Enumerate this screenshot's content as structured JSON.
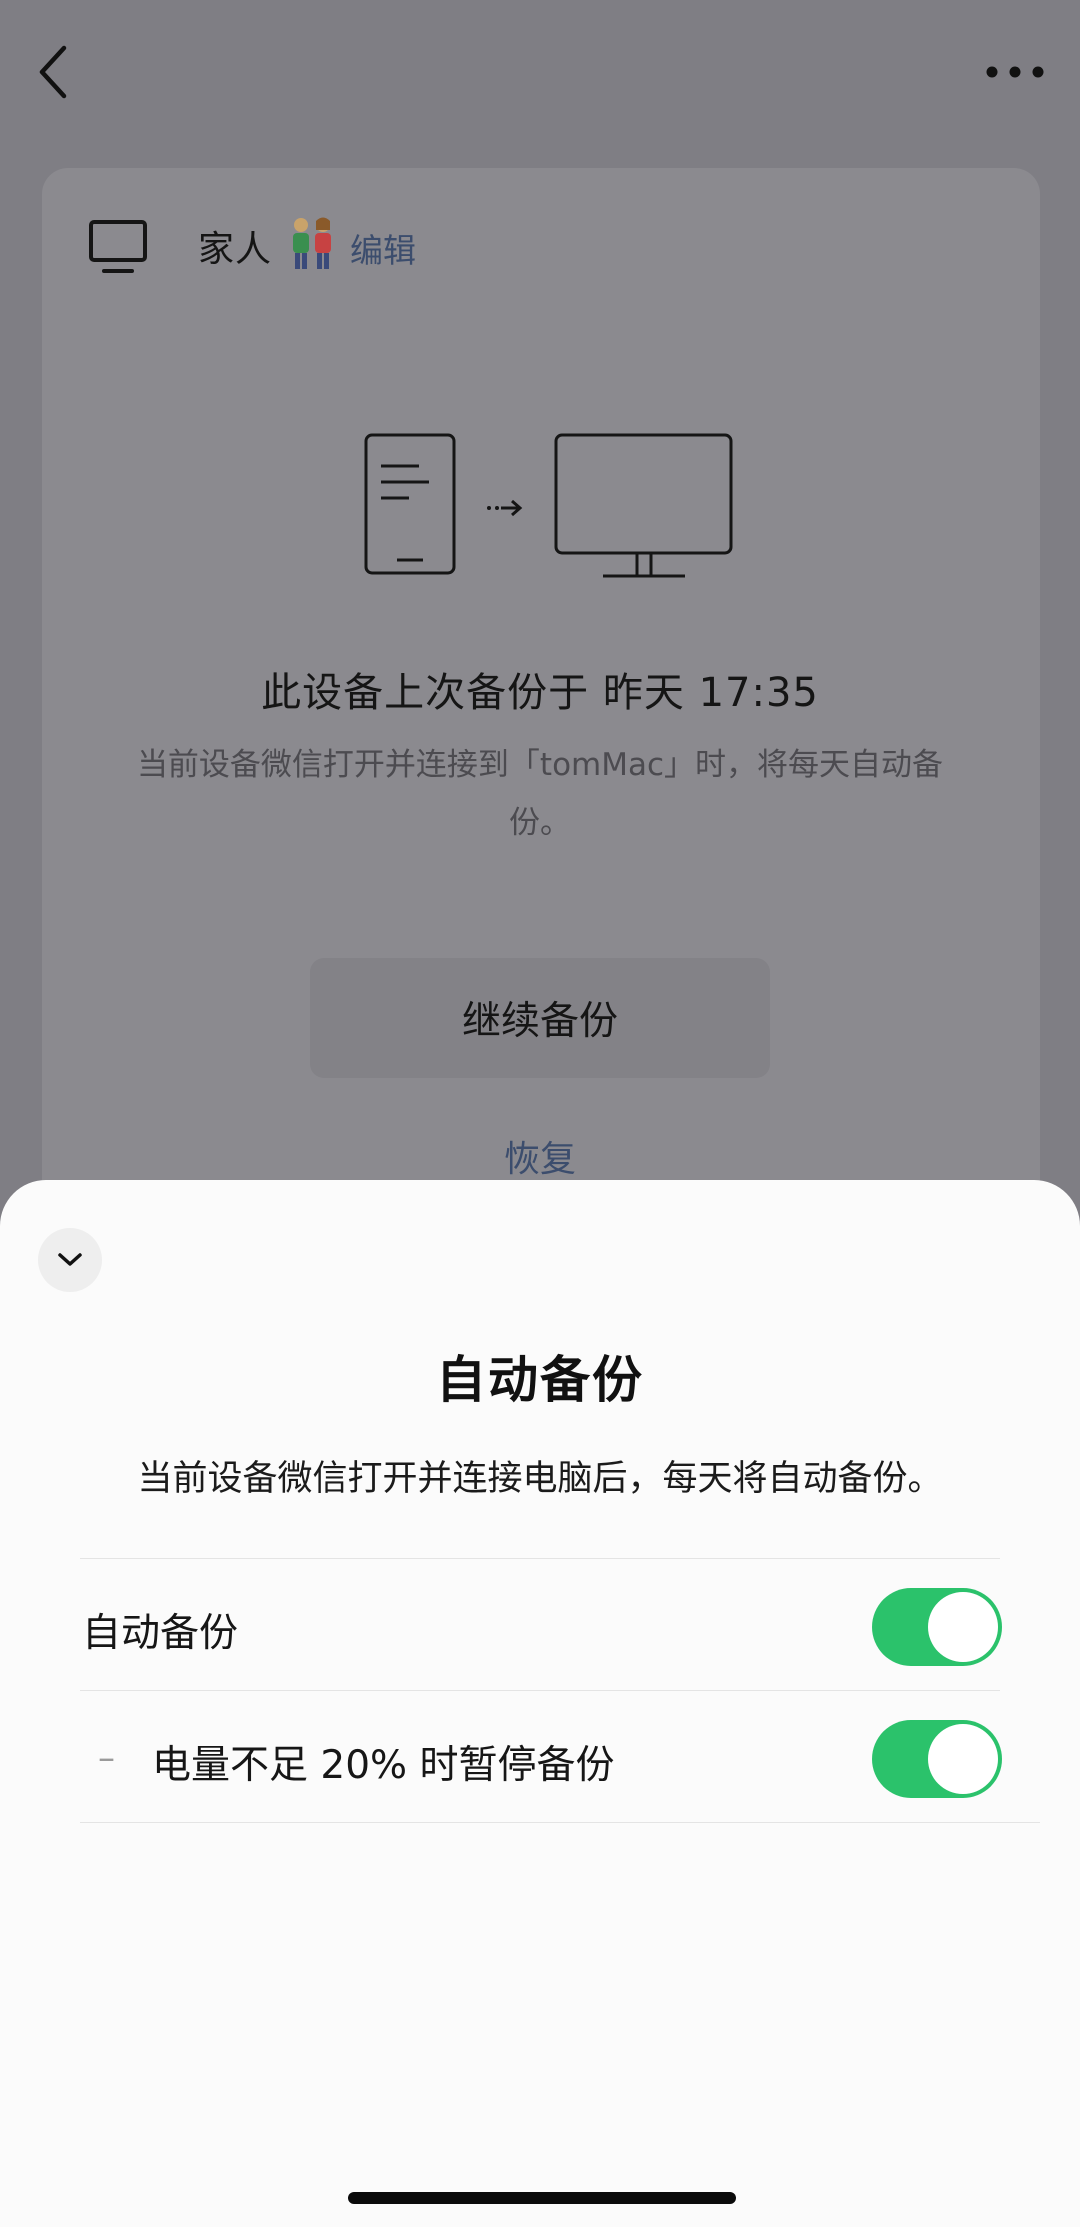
{
  "device": {
    "name": "家人",
    "edit_label": "编辑"
  },
  "backup_status": {
    "title": "此设备上次备份于 昨天 17:35",
    "description": "当前设备微信打开并连接到「tomMac」时，将每天自动备份。"
  },
  "actions": {
    "continue_label": "继续备份",
    "restore_label": "恢复"
  },
  "sheet": {
    "title": "自动备份",
    "description": "当前设备微信打开并连接电脑后，每天将自动备份。",
    "options": [
      {
        "label": "自动备份",
        "enabled": true
      },
      {
        "label": "电量不足 20% 时暂停备份",
        "enabled": true
      }
    ],
    "sub_option_marker": "–"
  },
  "colors": {
    "toggle_on": "#2bc26b",
    "link": "#3c4d6d",
    "overlay": "#7f7e84"
  }
}
